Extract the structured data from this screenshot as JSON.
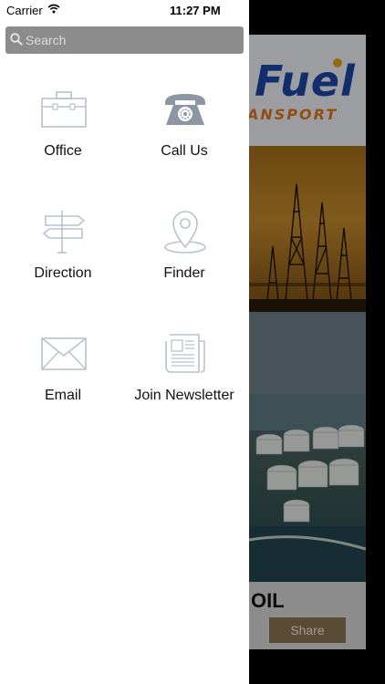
{
  "status_bar": {
    "carrier": "Carrier",
    "time": "11:27 PM"
  },
  "search": {
    "placeholder": "Search"
  },
  "menu": {
    "items": [
      {
        "label": "Office",
        "icon": "briefcase-icon"
      },
      {
        "label": "Call Us",
        "icon": "telephone-icon"
      },
      {
        "label": "Direction",
        "icon": "signpost-icon"
      },
      {
        "label": "Finder",
        "icon": "location-pin-icon"
      },
      {
        "label": "Email",
        "icon": "envelope-icon"
      },
      {
        "label": "Join Newsletter",
        "icon": "newspaper-icon"
      }
    ]
  },
  "background": {
    "logo_text": "Fuel",
    "logo_sub": "ANSPORT",
    "truck_text": "OIL",
    "share_label": "Share"
  },
  "colors": {
    "drawer_bg": "#ffffff",
    "search_bg": "#8c8c8c",
    "icon_stroke": "#b9c2cc",
    "phone_fill": "#8c97a3",
    "share_bg": "#8b7650"
  }
}
